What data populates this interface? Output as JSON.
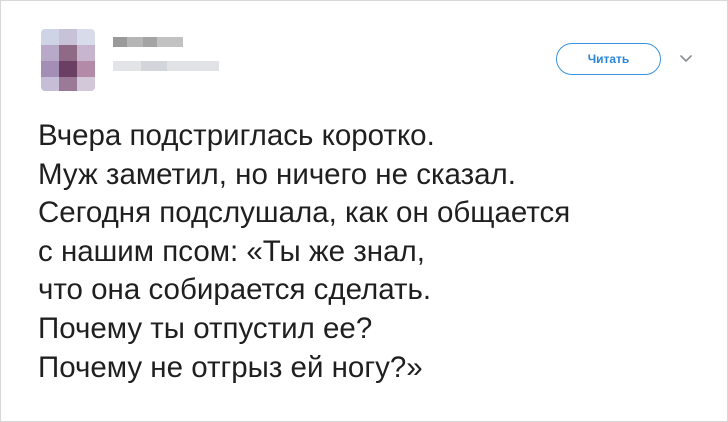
{
  "tweet": {
    "follow_label": "Читать",
    "lines": [
      "Вчера подстриглась коротко.",
      "Муж заметил, но ничего не сказал.",
      "Сегодня подслушала, как он общается",
      "с нашим псом: «Ты же знал,",
      "что она собирается сделать.",
      "Почему ты отпустил ее?",
      "Почему не отгрыз ей ногу?»"
    ]
  },
  "icons": {
    "menu": "chevron-down-icon"
  },
  "colors": {
    "accent": "#2b86d8",
    "text": "#1f1f1f",
    "border": "#d7d7d7"
  }
}
